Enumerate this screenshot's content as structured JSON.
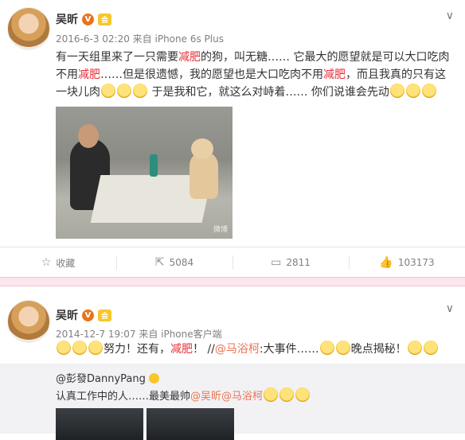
{
  "post1": {
    "author": "吴昕",
    "meta": "2016-6-3 02:20 来自 iPhone 6s Plus",
    "line1": "有一天组里来了一只需要",
    "line1_red": "减肥",
    "line1_rest": "的狗，叫无糖…… 它最大的愿望就是可以大口吃肉",
    "line2_a": "不用",
    "line2_red": "减肥",
    "line2_b": "……但是很遗憾，我的愿望也是大口吃肉不用",
    "line2_red2": "减肥",
    "line2_c": "，而且我真的只有这",
    "line3_a": "一块儿肉",
    "line3_b": " 于是我和它，就这么对峙着…… 你们说谁会先动",
    "photo_watermark": "微博",
    "actions": {
      "favorite": "收藏",
      "repost": "5084",
      "comment": "2811",
      "like": "103173"
    }
  },
  "post2": {
    "author": "吴昕",
    "meta": "2014-12-7 19:07 来自 iPhone客户端",
    "text_a": "努力！还有，",
    "text_red": "减肥",
    "text_b": "！ //",
    "mention1": "@马浴柯",
    "text_c": ":大事件……",
    "text_d": "晚点揭秘！",
    "repost_author": "@彭發DannyPang",
    "repost_text": "认真工作中的人……最美最帅",
    "repost_mention1": "@吴昕",
    "repost_mention2": "@马浴柯"
  },
  "icons": {
    "verified": "V",
    "member": "会",
    "chevron": "∨"
  }
}
